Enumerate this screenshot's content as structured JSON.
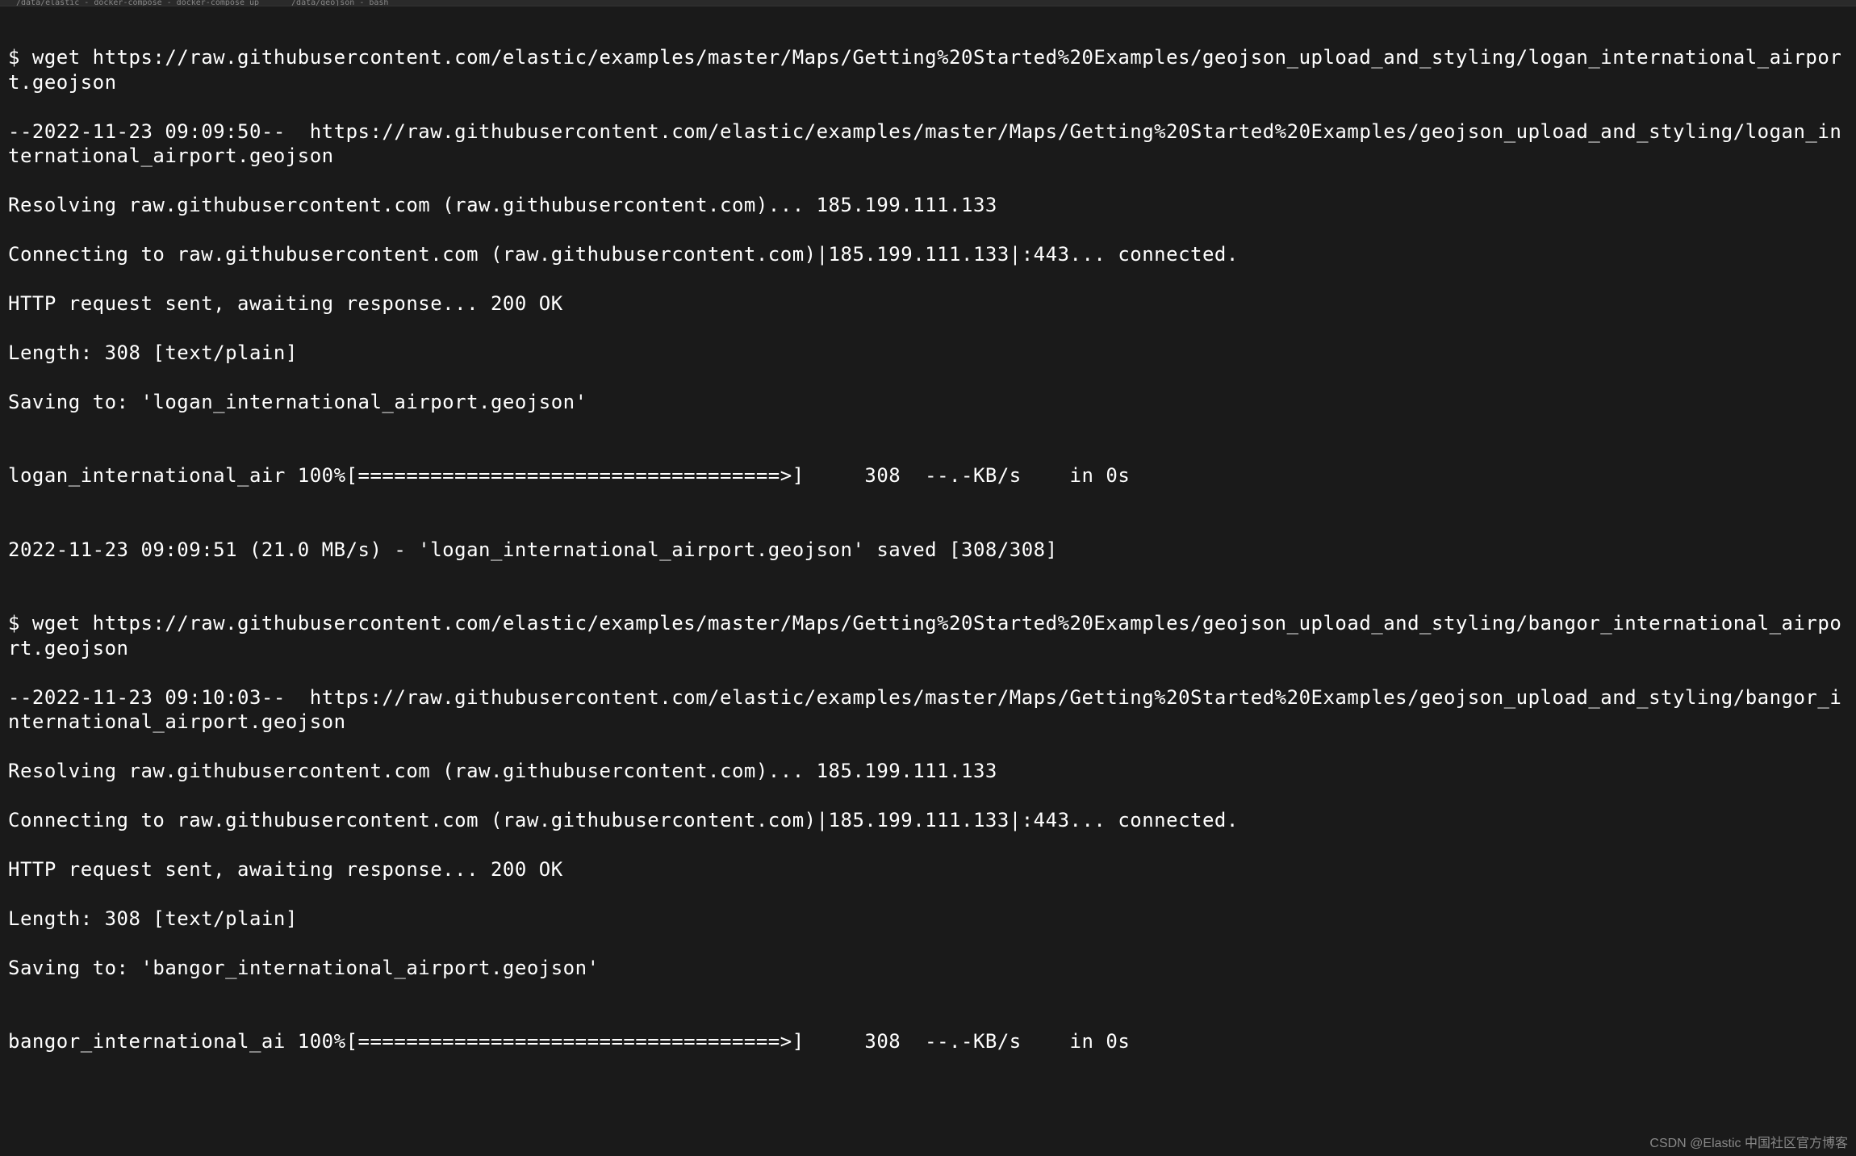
{
  "tabs": {
    "left": "/data/elastic - docker-compose - docker-compose up",
    "right": "/data/geojson - bash"
  },
  "terminal": {
    "l1": "$ wget https://raw.githubusercontent.com/elastic/examples/master/Maps/Getting%20Started%20Examples/geojson_upload_and_styling/logan_international_airport.geojson",
    "l2": "--2022-11-23 09:09:50--  https://raw.githubusercontent.com/elastic/examples/master/Maps/Getting%20Started%20Examples/geojson_upload_and_styling/logan_international_airport.geojson",
    "l3": "Resolving raw.githubusercontent.com (raw.githubusercontent.com)... 185.199.111.133",
    "l4": "Connecting to raw.githubusercontent.com (raw.githubusercontent.com)|185.199.111.133|:443... connected.",
    "l5": "HTTP request sent, awaiting response... 200 OK",
    "l6": "Length: 308 [text/plain]",
    "l7": "Saving to: 'logan_international_airport.geojson'",
    "l8": "",
    "l9": "logan_international_air 100%[===================================>]     308  --.-KB/s    in 0s",
    "l10": "",
    "l11": "2022-11-23 09:09:51 (21.0 MB/s) - 'logan_international_airport.geojson' saved [308/308]",
    "l12": "",
    "l13": "$ wget https://raw.githubusercontent.com/elastic/examples/master/Maps/Getting%20Started%20Examples/geojson_upload_and_styling/bangor_international_airport.geojson",
    "l14": "--2022-11-23 09:10:03--  https://raw.githubusercontent.com/elastic/examples/master/Maps/Getting%20Started%20Examples/geojson_upload_and_styling/bangor_international_airport.geojson",
    "l15": "Resolving raw.githubusercontent.com (raw.githubusercontent.com)... 185.199.111.133",
    "l16": "Connecting to raw.githubusercontent.com (raw.githubusercontent.com)|185.199.111.133|:443... connected.",
    "l17": "HTTP request sent, awaiting response... 200 OK",
    "l18": "Length: 308 [text/plain]",
    "l19": "Saving to: 'bangor_international_airport.geojson'",
    "l20": "",
    "l21": "bangor_international_ai 100%[===================================>]     308  --.-KB/s    in 0s"
  },
  "watermark": "CSDN @Elastic 中国社区官方博客"
}
